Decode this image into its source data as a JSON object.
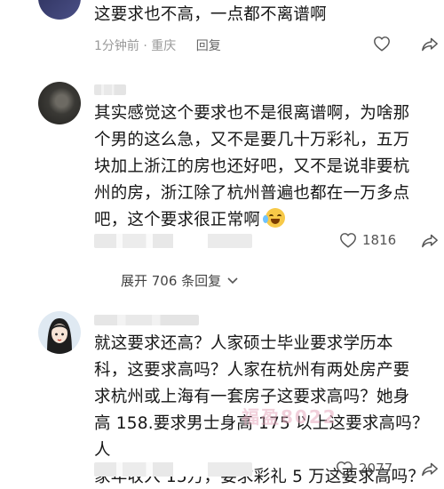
{
  "comments": [
    {
      "text": "这要求也不高，一点都不离谱啊",
      "time": "1分钟前",
      "location": "重庆",
      "reply_label": "回复"
    },
    {
      "lines": [
        "其实感觉这个要求也不是很离谱啊，为啥那",
        "个男的这么急，又不是要几十万彩礼，五万",
        "块加上浙江的房也还好吧，又不是说非要杭",
        "州的房，浙江除了杭州普遍也都在一万多点",
        "吧，这个要求很正常啊"
      ],
      "emoji": "crying-laughing-emoji",
      "likes": "1816",
      "expand_label": "展开 706 条回复"
    },
    {
      "lines": [
        "就这要求还高？人家硕士毕业要求学历本",
        "科，这要求高吗？人家在杭州有两处房产要",
        "求杭州或上海有一套房子这要求高吗？她身",
        "高 158.要求男士身高 175 以上这要求高吗？人",
        "家年收入 15万，要求彩礼 5 万这要求高吗？"
      ],
      "likes": "2077"
    }
  ],
  "watermark": "福盈8022",
  "icons": {
    "heart": "heart-outline-icon",
    "share": "share-arrow-icon",
    "chevron": "chevron-down-icon"
  },
  "colors": {
    "text": "#161616",
    "meta": "#9a9a9a",
    "icon": "#555555"
  }
}
